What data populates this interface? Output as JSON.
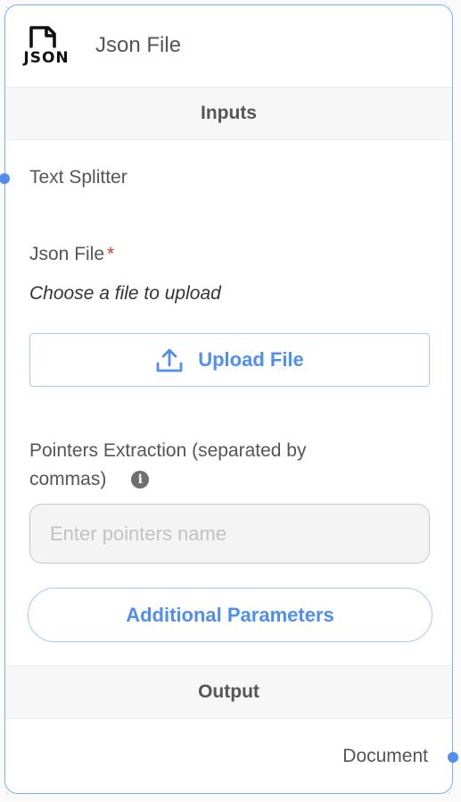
{
  "node": {
    "title": "Json File",
    "icon": "json-file-icon",
    "icon_text": "JSON",
    "accent_color": "#4f8ff0"
  },
  "inputs_section": {
    "title": "Inputs",
    "text_splitter_label": "Text Splitter",
    "json_file": {
      "label": "Json File",
      "required_mark": "*",
      "hint": "Choose a file to upload",
      "upload_label": "Upload File",
      "upload_icon": "upload-icon"
    },
    "pointers": {
      "label_line1": "Pointers Extraction (separated by",
      "label_line2": "commas)",
      "info_icon": "info-icon",
      "placeholder": "Enter pointers name",
      "value": ""
    },
    "additional_params_label": "Additional Parameters"
  },
  "output_section": {
    "title": "Output",
    "document_label": "Document"
  }
}
